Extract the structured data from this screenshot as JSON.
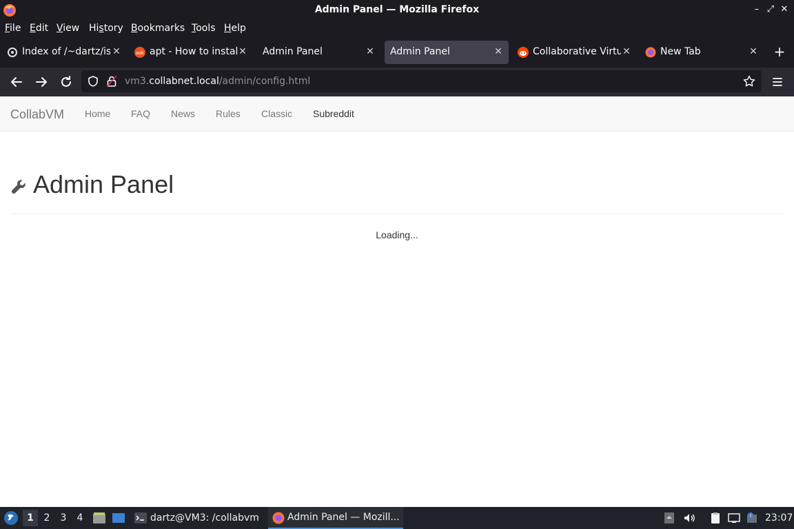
{
  "window": {
    "title": "Admin Panel — Mozilla Firefox",
    "controls": {
      "minimize": "–",
      "maximize": "⤢",
      "close": "✕"
    }
  },
  "menubar": {
    "items": [
      {
        "label": "File",
        "mnemonic": "F",
        "rest": "ile"
      },
      {
        "label": "Edit",
        "mnemonic": "E",
        "rest": "dit"
      },
      {
        "label": "View",
        "mnemonic": "V",
        "rest": "iew"
      },
      {
        "label": "History",
        "pre": "Hi",
        "mnemonic": "s",
        "rest": "tory"
      },
      {
        "label": "Bookmarks",
        "mnemonic": "B",
        "rest": "ookmarks"
      },
      {
        "label": "Tools",
        "mnemonic": "T",
        "rest": "ools"
      },
      {
        "label": "Help",
        "mnemonic": "H",
        "rest": "elp"
      }
    ]
  },
  "tabs": [
    {
      "label": "Index of /~dartz/iso",
      "icon": "page-icon",
      "active": false
    },
    {
      "label": "apt - How to install",
      "icon": "askubuntu-icon",
      "active": false
    },
    {
      "label": "Admin Panel",
      "icon": "none",
      "active": false
    },
    {
      "label": "Admin Panel",
      "icon": "none",
      "active": true
    },
    {
      "label": "Collaborative Virtua",
      "icon": "reddit-icon",
      "active": false
    },
    {
      "label": "New Tab",
      "icon": "firefox-icon",
      "active": false
    }
  ],
  "tab_close": "✕",
  "new_tab": "+",
  "urlbar": {
    "prefix": "vm3.",
    "domain": "collabnet.local",
    "path": "/admin/config.html"
  },
  "site": {
    "brand": "CollabVM",
    "nav": [
      "Home",
      "FAQ",
      "News",
      "Rules",
      "Classic",
      "Subreddit"
    ]
  },
  "main": {
    "title": "Admin Panel",
    "status": "Loading..."
  },
  "taskbar": {
    "workspaces": [
      "1",
      "2",
      "3",
      "4"
    ],
    "active_workspace": "1",
    "tasks": [
      {
        "label": "dartz@VM3: /collabvm",
        "icon": "terminal-icon"
      },
      {
        "label": "Admin Panel — Mozill...",
        "icon": "firefox-icon"
      }
    ],
    "clock": "23:07"
  },
  "colors": {
    "chrome_dark": "#1c1b22",
    "toolbar": "#2b2a33",
    "active_tab": "#42414d",
    "site_nav_bg": "#f8f8f8",
    "accent": "#4a90d9"
  }
}
